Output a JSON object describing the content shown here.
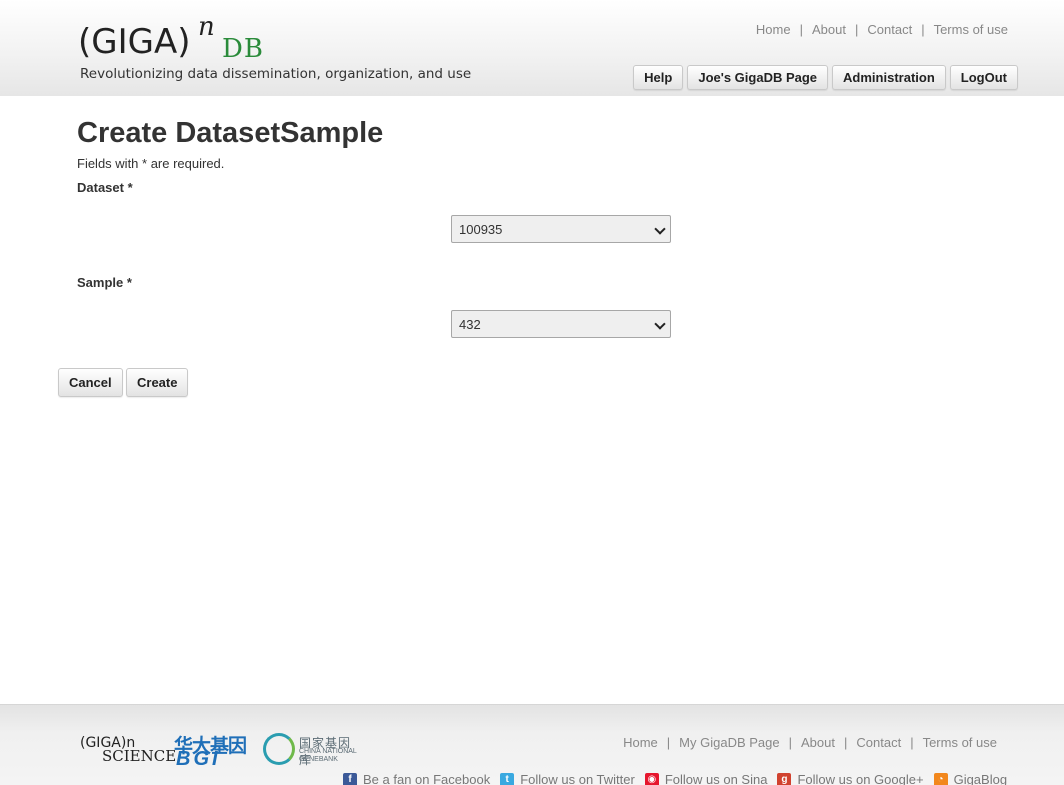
{
  "header": {
    "logo": {
      "main": "(GIGA)",
      "superscript": "n",
      "db": "DB",
      "tagline": "Revolutionizing data dissemination, organization, and use"
    },
    "topnav": [
      "Home",
      "About",
      "Contact",
      "Terms of use"
    ],
    "buttons": [
      "Help",
      "Joe's GigaDB Page",
      "Administration",
      "LogOut"
    ]
  },
  "main": {
    "title": "Create DatasetSample",
    "required_note": "Fields with * are required.",
    "dataset": {
      "label": "Dataset *",
      "value": "100935"
    },
    "sample": {
      "label": "Sample *",
      "value": "432"
    },
    "cancel_label": "Cancel",
    "create_label": "Create"
  },
  "footer": {
    "logos": {
      "gigascience": {
        "top": "(GIGA)n",
        "bottom": "SCIENCE"
      },
      "bgi": {
        "top": "华大基因",
        "bottom": "BGI"
      },
      "cngb": {
        "top": "国家基因库",
        "bottom": "CHINA NATIONAL GENEBANK"
      }
    },
    "nav": [
      "Home",
      "My GigaDB Page",
      "About",
      "Contact",
      "Terms of use"
    ],
    "social": [
      {
        "icon": "facebook-icon",
        "label": "Be a fan on Facebook"
      },
      {
        "icon": "twitter-icon",
        "label": "Follow us on Twitter"
      },
      {
        "icon": "sina-icon",
        "label": "Follow us on Sina"
      },
      {
        "icon": "google-plus-icon",
        "label": "Follow us on Google+"
      },
      {
        "icon": "rss-icon",
        "label": "GigaBlog"
      }
    ]
  },
  "colors": {
    "brand_green": "#2a8b3a",
    "link_gray": "#888888",
    "bgi_blue": "#1f6fb8"
  }
}
